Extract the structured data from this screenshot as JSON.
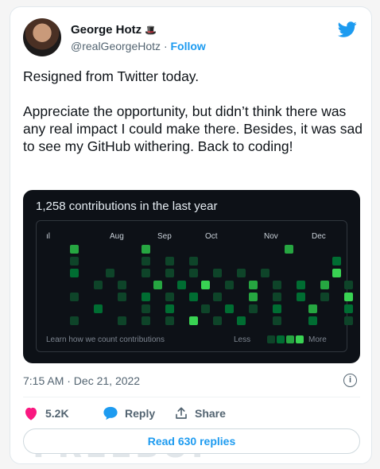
{
  "user": {
    "name": "George Hotz",
    "handle": "@realGeorgeHotz",
    "separator": "·",
    "follow_label": "Follow"
  },
  "tweet": {
    "text": "Resigned from Twitter today.\n\nAppreciate the opportunity, but didn’t think there was any real impact I could make there. Besides, it was sad to see my GitHub withering. Back to coding!",
    "timestamp": "7:15 AM · Dec 21, 2022"
  },
  "github": {
    "title": "1,258 contributions in the last year",
    "months": [
      "ıl",
      "Aug",
      "Sep",
      "Oct",
      "Nov",
      "Dec"
    ],
    "footer_link": "Learn how we count contributions",
    "less_label": "Less",
    "more_label": "More",
    "legend_levels": [
      "#0e4429",
      "#006d32",
      "#26a641",
      "#39d353"
    ],
    "empty_color": "#161b22"
  },
  "actions": {
    "likes": "5.2K",
    "reply_label": "Reply",
    "share_label": "Share"
  },
  "read_replies_label": "Read 630 replies",
  "watermark": "FREEBUF",
  "colors": {
    "accent": "#1d9bf0",
    "like": "#f91880",
    "reply": "#1d9bf0"
  }
}
